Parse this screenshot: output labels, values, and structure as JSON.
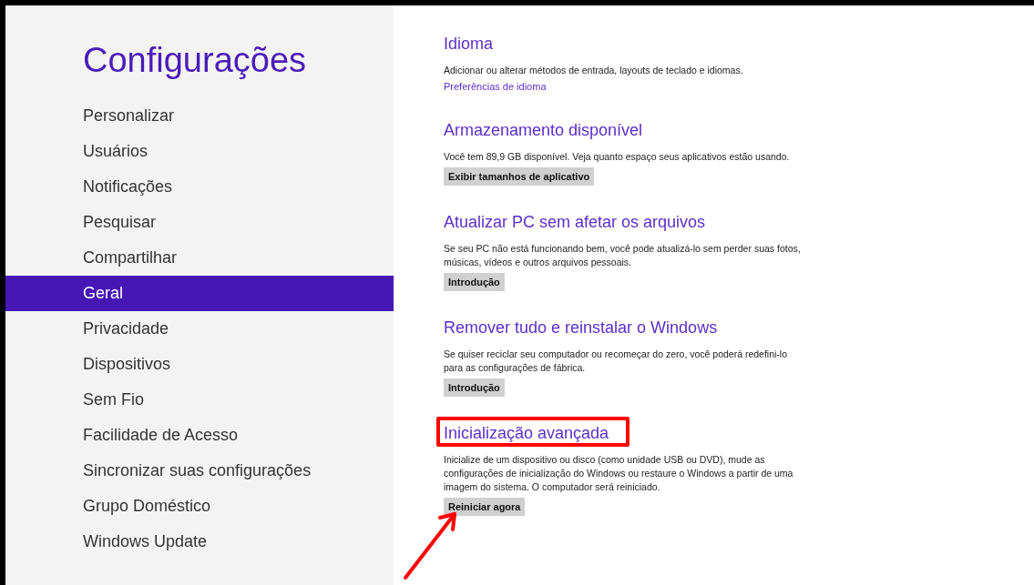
{
  "sidebar": {
    "title": "Configurações",
    "items": [
      {
        "label": "Personalizar",
        "selected": false
      },
      {
        "label": "Usuários",
        "selected": false
      },
      {
        "label": "Notificações",
        "selected": false
      },
      {
        "label": "Pesquisar",
        "selected": false
      },
      {
        "label": "Compartilhar",
        "selected": false
      },
      {
        "label": "Geral",
        "selected": true
      },
      {
        "label": "Privacidade",
        "selected": false
      },
      {
        "label": "Dispositivos",
        "selected": false
      },
      {
        "label": "Sem Fio",
        "selected": false
      },
      {
        "label": "Facilidade de Acesso",
        "selected": false
      },
      {
        "label": "Sincronizar suas configurações",
        "selected": false
      },
      {
        "label": "Grupo Doméstico",
        "selected": false
      },
      {
        "label": "Windows Update",
        "selected": false
      }
    ]
  },
  "sections": [
    {
      "heading": "Idioma",
      "description": "Adicionar ou alterar métodos de entrada, layouts de teclado e idiomas.",
      "kind": "link",
      "action": "Preferências de idioma",
      "highlighted": false,
      "pointed": false
    },
    {
      "heading": "Armazenamento disponível",
      "description": "Você tem 89,9 GB disponível. Veja quanto espaço seus aplicativos estão usando.",
      "kind": "button",
      "action": "Exibir tamanhos de aplicativo",
      "highlighted": false,
      "pointed": false
    },
    {
      "heading": "Atualizar PC sem afetar os arquivos",
      "description": "Se seu PC não está funcionando bem, você pode atualizá-lo sem perder suas fotos, músicas, vídeos e outros arquivos pessoais.",
      "kind": "button",
      "action": "Introdução",
      "highlighted": false,
      "pointed": false
    },
    {
      "heading": "Remover tudo e reinstalar o Windows",
      "description": "Se quiser reciclar seu computador ou recomeçar do zero, você poderá redefini-lo para as configurações de fábrica.",
      "kind": "button",
      "action": "Introdução",
      "highlighted": false,
      "pointed": false
    },
    {
      "heading": "Inicialização avançada",
      "description": "Inicialize de um dispositivo ou disco (como unidade USB ou DVD), mude as configurações de inicialização do Windows ou restaure o Windows a partir de uma imagem do sistema. O computador será reiniciado.",
      "kind": "button",
      "action": "Reiniciar agora",
      "highlighted": true,
      "pointed": true
    }
  ]
}
